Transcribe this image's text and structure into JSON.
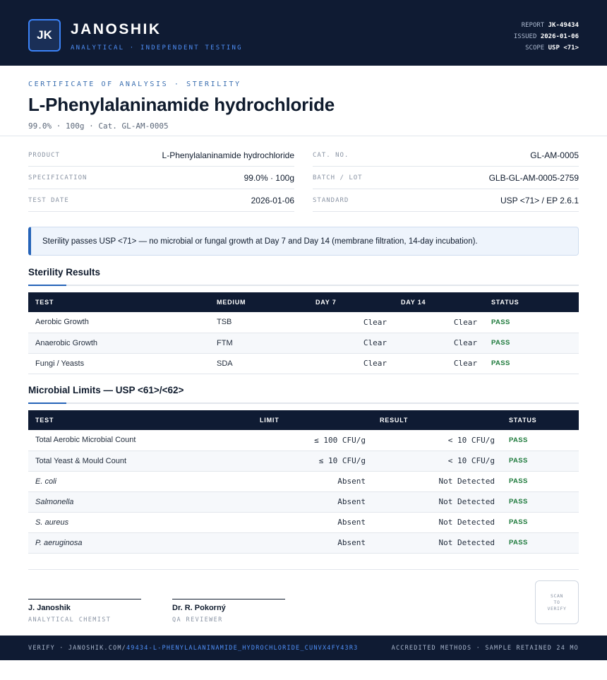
{
  "header": {
    "logo_initials": "JK",
    "brand": "JANOSHIK",
    "tagline": "ANALYTICAL · INDEPENDENT TESTING",
    "report_label": "REPORT",
    "report_value": "JK-49434",
    "issued_label": "ISSUED",
    "issued_value": "2026-01-06",
    "scope_label": "SCOPE",
    "scope_value": "USP <71>"
  },
  "title_block": {
    "cert_label": "CERTIFICATE OF ANALYSIS · STERILITY",
    "title": "L-Phenylalaninamide hydrochloride",
    "subtitle": "99.0% · 100g  ·  Cat. GL-AM-0005"
  },
  "info_left": [
    {
      "key": "PRODUCT",
      "value": "L-Phenylalaninamide hydrochloride"
    },
    {
      "key": "SPECIFICATION",
      "value": "99.0% · 100g"
    },
    {
      "key": "TEST DATE",
      "value": "2026-01-06"
    }
  ],
  "info_right": [
    {
      "key": "CAT. NO.",
      "value": "GL-AM-0005"
    },
    {
      "key": "BATCH / LOT",
      "value": "GLB-GL-AM-0005-2759"
    },
    {
      "key": "STANDARD",
      "value": "USP <71> / EP 2.6.1"
    }
  ],
  "notice": "Sterility passes USP <71> — no microbial or fungal growth at Day 7 and Day 14 (membrane filtration, 14-day incubation).",
  "sterility": {
    "title": "Sterility Results",
    "headers": [
      "TEST",
      "MEDIUM",
      "DAY 7",
      "DAY 14",
      "STATUS"
    ],
    "rows": [
      {
        "test": "Aerobic Growth",
        "medium": "TSB",
        "day7": "Clear",
        "day14": "Clear",
        "status": "PASS"
      },
      {
        "test": "Anaerobic Growth",
        "medium": "FTM",
        "day7": "Clear",
        "day14": "Clear",
        "status": "PASS"
      },
      {
        "test": "Fungi / Yeasts",
        "medium": "SDA",
        "day7": "Clear",
        "day14": "Clear",
        "status": "PASS"
      }
    ]
  },
  "microbial": {
    "title": "Microbial Limits — USP <61>/<62>",
    "headers": [
      "TEST",
      "LIMIT",
      "RESULT",
      "STATUS"
    ],
    "rows": [
      {
        "test": "Total Aerobic Microbial Count",
        "limit": "≤ 100 CFU/g",
        "result": "< 10 CFU/g",
        "status": "PASS"
      },
      {
        "test": "Total Yeast & Mould Count",
        "limit": "≤ 10 CFU/g",
        "result": "< 10 CFU/g",
        "status": "PASS"
      },
      {
        "test": "E. coli",
        "limit": "Absent",
        "result": "Not Detected",
        "status": "PASS"
      },
      {
        "test": "Salmonella",
        "limit": "Absent",
        "result": "Not Detected",
        "status": "PASS"
      },
      {
        "test": "S. aureus",
        "limit": "Absent",
        "result": "Not Detected",
        "status": "PASS"
      },
      {
        "test": "P. aeruginosa",
        "limit": "Absent",
        "result": "Not Detected",
        "status": "PASS"
      }
    ]
  },
  "signatures": [
    {
      "name": "J. Janoshik",
      "role": "ANALYTICAL CHEMIST"
    },
    {
      "name": "Dr. R. Pokorný",
      "role": "QA REVIEWER"
    }
  ],
  "qr": {
    "line1": "SCAN",
    "line2": "TO",
    "line3": "VERIFY"
  },
  "footer": {
    "verify_prefix": "VERIFY · JANOSHIK.COM/",
    "verify_link": "49434-L-PHENYLALANINAMIDE_HYDROCHLORIDE_CUNVX4FY43R3",
    "right": "ACCREDITED METHODS · SAMPLE RETAINED 24 MO"
  }
}
